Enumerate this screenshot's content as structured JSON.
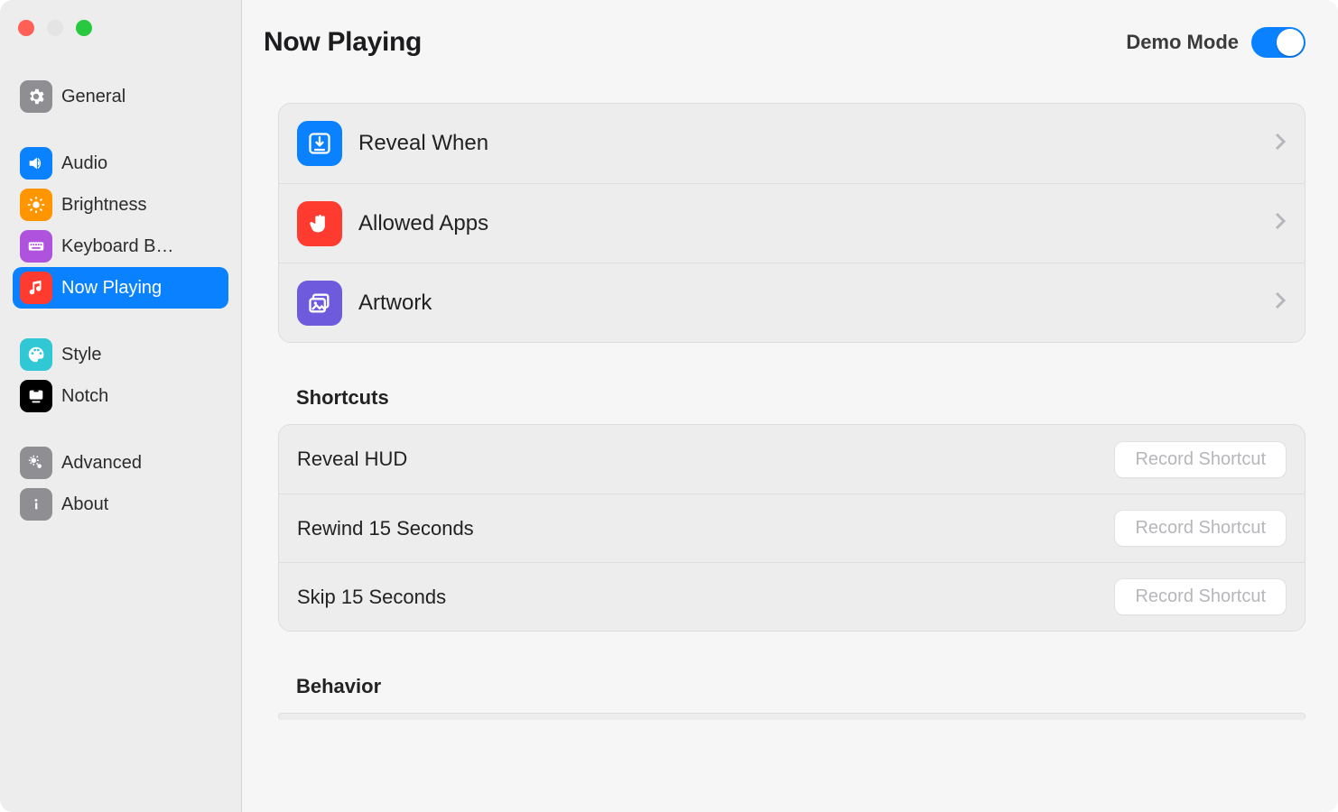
{
  "header": {
    "title": "Now Playing",
    "demo_label": "Demo Mode",
    "demo_on": true
  },
  "sidebar": {
    "groups": [
      [
        {
          "label": "General",
          "icon": "gear"
        }
      ],
      [
        {
          "label": "Audio",
          "icon": "speaker"
        },
        {
          "label": "Brightness",
          "icon": "sun"
        },
        {
          "label": "Keyboard B…",
          "icon": "keyboard"
        },
        {
          "label": "Now Playing",
          "icon": "music",
          "selected": true
        }
      ],
      [
        {
          "label": "Style",
          "icon": "palette"
        },
        {
          "label": "Notch",
          "icon": "notch"
        }
      ],
      [
        {
          "label": "Advanced",
          "icon": "cogs"
        },
        {
          "label": "About",
          "icon": "info"
        }
      ]
    ]
  },
  "main": {
    "section1": [
      {
        "label": "Reveal When",
        "icon": "download-box",
        "color": "ri-blue"
      },
      {
        "label": "Allowed Apps",
        "icon": "hand",
        "color": "ri-red"
      },
      {
        "label": "Artwork",
        "icon": "photos",
        "color": "ri-purple"
      }
    ],
    "shortcuts_header": "Shortcuts",
    "shortcuts": [
      {
        "label": "Reveal HUD",
        "button": "Record Shortcut"
      },
      {
        "label": "Rewind 15 Seconds",
        "button": "Record Shortcut"
      },
      {
        "label": "Skip 15 Seconds",
        "button": "Record Shortcut"
      }
    ],
    "behavior_header": "Behavior"
  }
}
